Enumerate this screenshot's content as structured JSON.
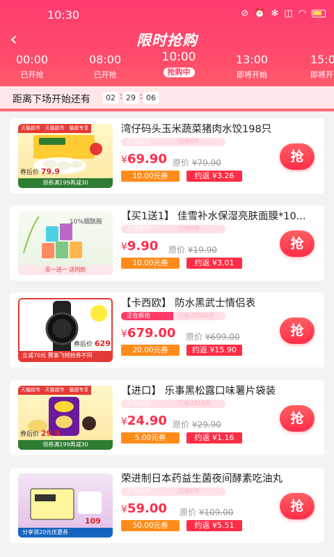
{
  "status_bar": {
    "time": "10:30"
  },
  "nav": {
    "back_icon": "chevron-left-icon",
    "title": "限时抢购"
  },
  "sessions": [
    {
      "time": "00:00",
      "status": "已开抢"
    },
    {
      "time": "08:00",
      "status": "已开抢"
    },
    {
      "time": "10:00",
      "status": "抢购中"
    },
    {
      "time": "13:00",
      "status": "即将开始"
    },
    {
      "time": "15:0",
      "status": "即将开"
    }
  ],
  "countdown": {
    "label": "距离下场开始还有",
    "hours": "02",
    "minutes": "29",
    "seconds": "06"
  },
  "colors": {
    "accent": "#ff3a66",
    "coupon": "#ff8c1a",
    "rebate": "#ff2d45"
  },
  "products": [
    {
      "name": "湾仔码头玉米蔬菜猪肉水饺198只",
      "progress_left": "正在疯抢",
      "progress_right": "已抢0件",
      "progress_fraction": 0.0,
      "currency": "¥",
      "price": "69.90",
      "original_label": "原价",
      "original_price": "¥79.90",
      "coupon": "10.00元券",
      "rebate": "约返 ¥3.26",
      "grab": "抢",
      "thumb": {
        "badge": "天猫超市 · 天猫超市 · 猫超专享",
        "strip": "领券满199再减30",
        "tag_prefix": "券后价",
        "tag_price": "79.9"
      }
    },
    {
      "name": "【买1送1】 佳雪补水保湿亮肤面膜*10...",
      "progress_left": "正在疯抢",
      "progress_right": "已抢0件",
      "progress_fraction": 0.0,
      "currency": "¥",
      "price": "9.90",
      "original_label": "原价",
      "original_price": "¥19.90",
      "coupon": "10.00元券",
      "rebate": "约返 ¥3.01",
      "grab": "抢",
      "thumb": {
        "badge": "10%烟酰胺",
        "strip": "买一送一  送同款",
        "tag_prefix": "",
        "tag_price": ""
      }
    },
    {
      "name": "【卡西欧】 防水黑武士情侣表",
      "progress_left": "正在疯抢",
      "progress_right": "已抢20500件",
      "progress_fraction": 0.5,
      "currency": "¥",
      "price": "679.00",
      "original_label": "原价",
      "original_price": "¥699.00",
      "coupon": "20.00元券",
      "rebate": "约返 ¥15.90",
      "grab": "抢",
      "thumb": {
        "badge": "",
        "strip": "立减70元 赛事飞特抢券不同",
        "tag_prefix": "券后价",
        "tag_price": "629"
      }
    },
    {
      "name": "【进口】 乐事黑松露口味薯片袋装",
      "progress_left": "正在疯抢",
      "progress_right": "已抢2418件",
      "progress_fraction": 0.0,
      "currency": "¥",
      "price": "24.90",
      "original_label": "原价",
      "original_price": "¥29.90",
      "coupon": "5.00元券",
      "rebate": "约返 ¥1.16",
      "grab": "抢",
      "thumb": {
        "badge": "天猫超市 · 天猫超市 · 猫超专享",
        "strip": "领券满199再减30",
        "tag_prefix": "券后价",
        "tag_price": "29.9"
      }
    },
    {
      "name": "荣进制日本药益生菌夜间酵素吃油丸",
      "progress_left": "正在疯抢",
      "progress_right": "已抢0件",
      "progress_fraction": 0.0,
      "currency": "¥",
      "price": "59.00",
      "original_label": "原价",
      "original_price": "¥109.00",
      "coupon": "50.00元券",
      "rebate": "约返 ¥5.51",
      "grab": "抢",
      "thumb": {
        "badge": "",
        "strip": "分享领20元优惠券",
        "tag_prefix": "券后价",
        "tag_price": "109"
      }
    }
  ]
}
